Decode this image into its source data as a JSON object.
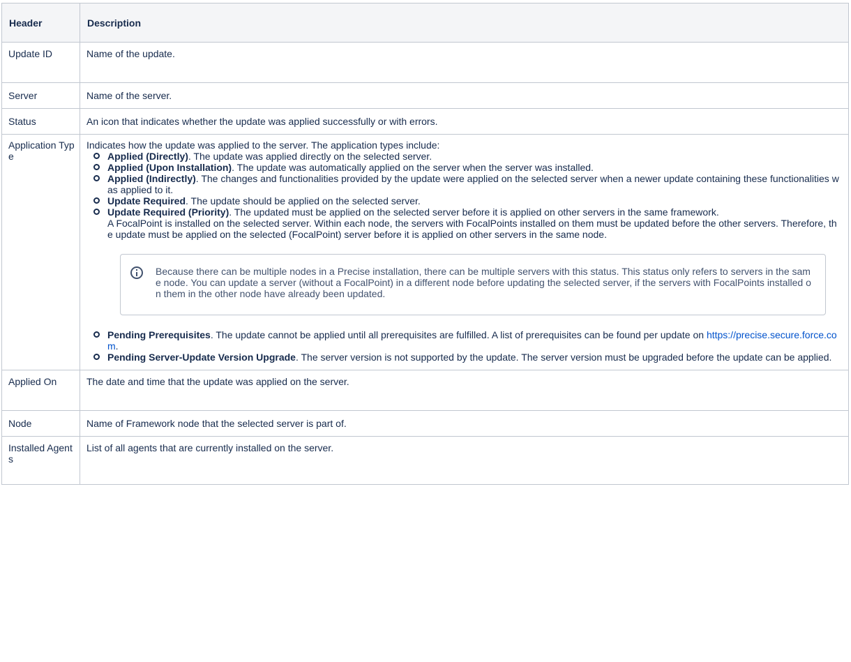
{
  "table": {
    "headers": [
      "Header",
      "Description"
    ],
    "rows": {
      "update_id": {
        "header": "Update ID",
        "description": "Name of the update."
      },
      "server": {
        "header": "Server",
        "description": "Name of the server."
      },
      "status": {
        "header": "Status",
        "description": "An icon that indicates whether the update was applied successfully or with errors."
      },
      "application_type": {
        "header": "Application Type",
        "intro": "Indicates how the update was applied to the server. The application types include:",
        "items": [
          {
            "term": "Applied (Directly)",
            "text": ". The update was applied directly on the selected server."
          },
          {
            "term": "Applied (Upon Installation)",
            "text": ". The update was automatically applied on the server when the server was installed."
          },
          {
            "term": "Applied (Indirectly)",
            "text": ". The changes and functionalities provided by the update were applied on the selected server when a newer update containing these functionalities was applied to it."
          },
          {
            "term": "Update Required",
            "text": ". The update should be applied on the selected server."
          },
          {
            "term": "Update Required (Priority)",
            "text": ". The updated must be applied on the selected server before it is applied on other servers in the same framework.",
            "extra": "A FocalPoint is installed on the selected server. Within each node, the servers with FocalPoints installed on them must be updated before the other servers. Therefore, the update must be applied on the selected (FocalPoint) server before it is applied on other servers in the same node."
          },
          {
            "term": "Pending Prerequisites",
            "text": ". The update cannot be applied until all prerequisites are fulfilled. A list of prerequisites can be found per update on ",
            "link": "https://precise.secure.force.com",
            "after_link": "."
          },
          {
            "term": "Pending Server-Update Version Upgrade",
            "text": ". The server version is not supported by the update. The server version must be upgraded before the update can be applied."
          }
        ],
        "note": "Because there can be multiple nodes in a Precise installation, there can be multiple servers with this status. This status only refers to servers in the same node. You can update a server (without a FocalPoint) in a different node before updating the selected server, if the servers with FocalPoints installed on them in the other node have already been updated."
      },
      "applied_on": {
        "header": "Applied On",
        "description": "The date and time that the update was applied on the server."
      },
      "node": {
        "header": "Node",
        "description": "Name of Framework node that the selected server is part of."
      },
      "installed_agents": {
        "header": "Installed Agents",
        "description": "List of all agents that are currently installed on the server."
      }
    }
  },
  "icons": {
    "note_icon": "info-icon",
    "bullet_icon": "hollow-circle-bullet"
  },
  "colors": {
    "link": "#0052cc",
    "header_bg": "#f4f5f7",
    "border": "#c1c7d0",
    "text": "#172b4d"
  }
}
